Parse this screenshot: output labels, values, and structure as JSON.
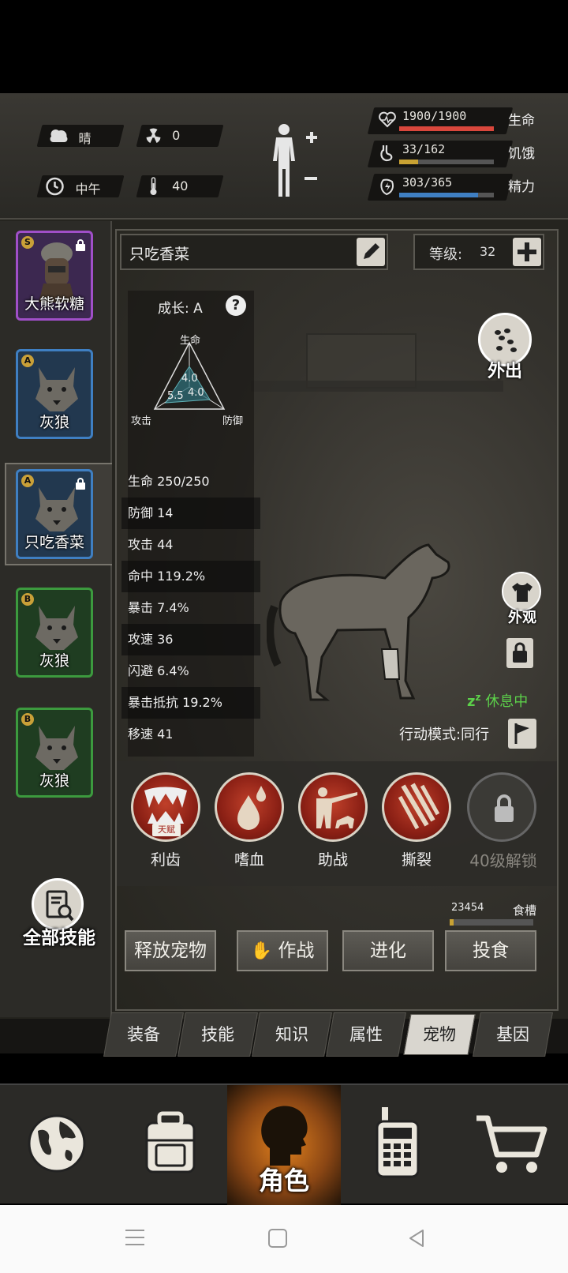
{
  "status": {
    "weather": "晴",
    "radiation": "0",
    "time_of_day": "中午",
    "temperature": "40",
    "vitals": [
      {
        "label": "生命",
        "value": "1900/1900",
        "fraction": 1.0,
        "color": "#d9473c"
      },
      {
        "label": "饥饿",
        "value": "33/162",
        "fraction": 0.2,
        "color": "#c9a233"
      },
      {
        "label": "精力",
        "value": "303/365",
        "fraction": 0.83,
        "color": "#3f7fc2"
      }
    ]
  },
  "pets": [
    {
      "name": "大熊软糖",
      "grade": "S",
      "locked": true,
      "frame_color": "#a04fc8",
      "bg": "#3c2850"
    },
    {
      "name": "灰狼",
      "grade": "A",
      "locked": false,
      "frame_color": "#3f7fc2",
      "bg": "#22384f"
    },
    {
      "name": "只吃香菜",
      "grade": "A",
      "locked": true,
      "frame_color": "#3f7fc2",
      "bg": "#22384f",
      "selected": true
    },
    {
      "name": "灰狼",
      "grade": "B",
      "locked": false,
      "frame_color": "#3c9a3e",
      "bg": "#1f3d21"
    },
    {
      "name": "灰狼",
      "grade": "B",
      "locked": false,
      "frame_color": "#3c9a3e",
      "bg": "#1f3d21"
    }
  ],
  "all_skills_label": "全部技能",
  "pet_detail": {
    "name": "只吃香菜",
    "level_label": "等级:",
    "level": "32",
    "growth_label": "成长: A",
    "radar": {
      "top": "生命",
      "left": "攻击",
      "right": "防御",
      "v_top": "4.0",
      "v_left": "5.5",
      "v_right": "4.0"
    },
    "stats": [
      "生命 250/250",
      "防御 14",
      "攻击 44",
      "命中 119.2%",
      "暴击 7.4%",
      "攻速 36",
      "闪避 6.4%",
      "暴击抵抗 19.2%",
      "移速 41"
    ],
    "go_out_label": "外出",
    "appearance_label": "外观",
    "resting_label": "休息中",
    "action_mode": "行动模式:同行"
  },
  "skills": [
    {
      "label": "利齿",
      "badge": "天赋"
    },
    {
      "label": "嗜血"
    },
    {
      "label": "助战"
    },
    {
      "label": "撕裂"
    },
    {
      "label": "40级解锁",
      "locked": true
    }
  ],
  "food": {
    "value": "23454",
    "label": "食槽",
    "fraction": 0.05
  },
  "buttons": {
    "release": "释放宠物",
    "fight": "作战",
    "evolve": "进化",
    "feed": "投食"
  },
  "tabs": [
    "装备",
    "技能",
    "知识",
    "属性",
    "宠物",
    "基因"
  ],
  "active_tab": "宠物",
  "bottom_nav": {
    "character": "角色"
  },
  "colors": {
    "accent_orange": "#e0801d",
    "resting_green": "#5cd14a"
  }
}
